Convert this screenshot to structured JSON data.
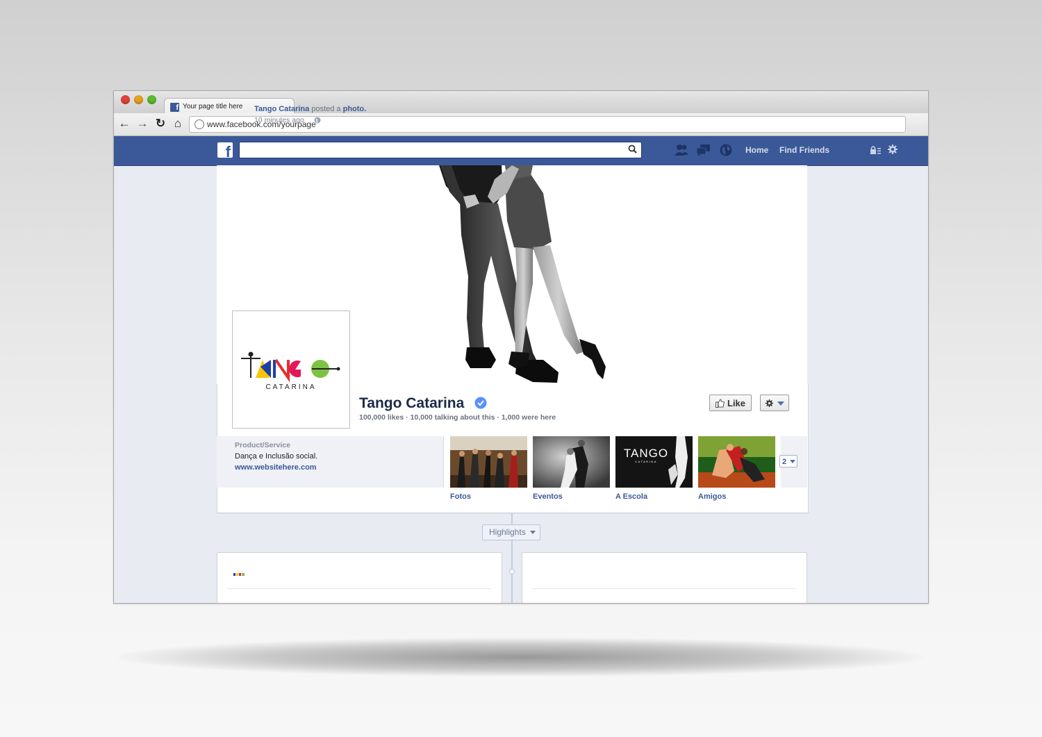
{
  "browser": {
    "tab_title": "Your page title here",
    "url": "www.facebook.com/yourpage"
  },
  "fb_bar": {
    "search_placeholder": "",
    "nav": {
      "home": "Home",
      "find_friends": "Find Friends"
    }
  },
  "page": {
    "name": "Tango Catarina",
    "stats": "100,000 likes · 10,000 talking about this · 1,000 were here",
    "like_label": "Like",
    "logo_text": "TANGO",
    "logo_sub": "CATARINA"
  },
  "about": {
    "category": "Product/Service",
    "description": "Dança e Inclusão social.",
    "website": "www.websitehere.com"
  },
  "apps": [
    {
      "label": "Fotos"
    },
    {
      "label": "Eventos"
    },
    {
      "label": "A Escola"
    },
    {
      "label": "Amigos"
    }
  ],
  "apps_more_count": "2",
  "timeline": {
    "highlights_label": "Highlights",
    "post": {
      "author": "Tango Catarina",
      "action": "posted a",
      "object": "photo.",
      "time": "10 minutes ago"
    }
  },
  "colors": {
    "facebook_blue": "#3b5998",
    "page_background": "#e9ebf3"
  }
}
